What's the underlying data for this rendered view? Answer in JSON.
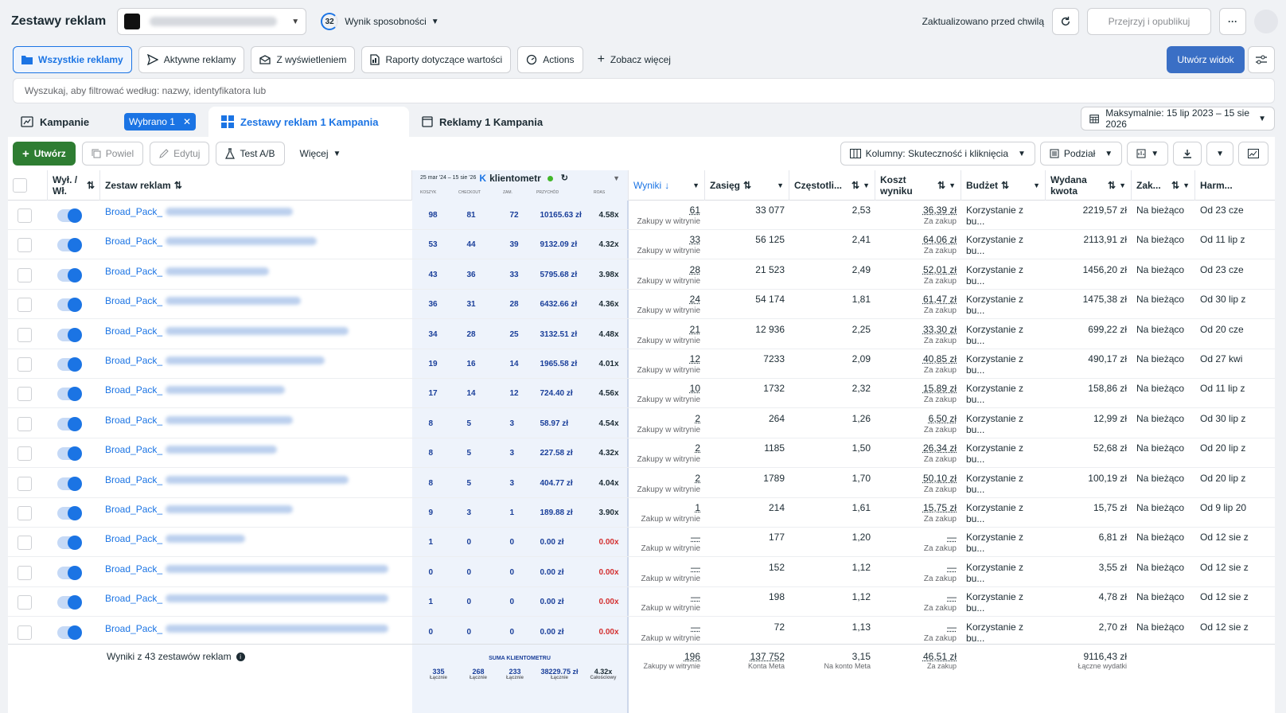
{
  "header": {
    "title": "Zestawy reklam",
    "score_value": "32",
    "score_label": "Wynik sposobności",
    "updated": "Zaktualizowano przed chwilą",
    "review_publish": "Przejrzyj i opublikuj",
    "more": "···"
  },
  "views": {
    "items": [
      "Wszystkie reklamy",
      "Aktywne reklamy",
      "Z wyświetleniem",
      "Raporty dotyczące wartości",
      "Actions",
      "Zobacz więcej"
    ],
    "create_view": "Utwórz widok"
  },
  "search": {
    "placeholder": "Wyszukaj, aby filtrować według: nazwy, identyfikatora lub"
  },
  "levels": {
    "campaigns": "Kampanie",
    "selected_chip": "Wybrano 1",
    "adsets": "Zestawy reklam 1 Kampania",
    "ads": "Reklamy 1 Kampania",
    "date_range": "Maksymalnie: 15 lip 2023 – 15 sie 2026"
  },
  "toolbar": {
    "create": "Utwórz",
    "duplicate": "Powiel",
    "edit": "Edytuj",
    "abtest": "Test A/B",
    "more": "Więcej",
    "columns": "Kolumny: Skuteczność i kliknięcia",
    "breakdown": "Podział"
  },
  "columns": {
    "onoff": "Wył. / Wł.",
    "adset": "Zestaw reklam",
    "kt_date": "25 mar '24 – 15 sie '26",
    "kt_brand": "klientometr",
    "kt_sub": [
      "KOSZYK",
      "CHECKOUT",
      "ZAM.",
      "PRZYCHÓD",
      "ROAS"
    ],
    "results": "Wyniki",
    "reach": "Zasięg",
    "frequency": "Częstotli...",
    "cost": "Koszt wyniku",
    "budget": "Budżet",
    "spent": "Wydana kwota",
    "end": "Zak...",
    "schedule": "Harm..."
  },
  "rows": [
    {
      "name": "Broad_Pack_",
      "k1": "98",
      "k2": "81",
      "k3": "72",
      "rev": "10165.63 zł",
      "roas": "4.58x",
      "res": "61",
      "res_sub": "Zakupy w witrynie",
      "reach": "33 077",
      "freq": "2,53",
      "cost": "36,39 zł",
      "cost_sub": "Za zakup",
      "budget": "Korzystanie z bu...",
      "spent": "2219,57 zł",
      "end": "Na bieżąco",
      "sched": "Od 23 cze"
    },
    {
      "name": "Broad_Pack_",
      "k1": "53",
      "k2": "44",
      "k3": "39",
      "rev": "9132.09 zł",
      "roas": "4.32x",
      "res": "33",
      "res_sub": "Zakupy w witrynie",
      "reach": "56 125",
      "freq": "2,41",
      "cost": "64,06 zł",
      "cost_sub": "Za zakup",
      "budget": "Korzystanie z bu...",
      "spent": "2113,91 zł",
      "end": "Na bieżąco",
      "sched": "Od 11 lip z"
    },
    {
      "name": "Broad_Pack_",
      "k1": "43",
      "k2": "36",
      "k3": "33",
      "rev": "5795.68 zł",
      "roas": "3.98x",
      "res": "28",
      "res_sub": "Zakupy w witrynie",
      "reach": "21 523",
      "freq": "2,49",
      "cost": "52,01 zł",
      "cost_sub": "Za zakup",
      "budget": "Korzystanie z bu...",
      "spent": "1456,20 zł",
      "end": "Na bieżąco",
      "sched": "Od 23 cze"
    },
    {
      "name": "Broad_Pack_",
      "k1": "36",
      "k2": "31",
      "k3": "28",
      "rev": "6432.66 zł",
      "roas": "4.36x",
      "res": "24",
      "res_sub": "Zakupy w witrynie",
      "reach": "54 174",
      "freq": "1,81",
      "cost": "61,47 zł",
      "cost_sub": "Za zakup",
      "budget": "Korzystanie z bu...",
      "spent": "1475,38 zł",
      "end": "Na bieżąco",
      "sched": "Od 30 lip z"
    },
    {
      "name": "Broad_Pack_",
      "k1": "34",
      "k2": "28",
      "k3": "25",
      "rev": "3132.51 zł",
      "roas": "4.48x",
      "res": "21",
      "res_sub": "Zakupy w witrynie",
      "reach": "12 936",
      "freq": "2,25",
      "cost": "33,30 zł",
      "cost_sub": "Za zakup",
      "budget": "Korzystanie z bu...",
      "spent": "699,22 zł",
      "end": "Na bieżąco",
      "sched": "Od 20 cze"
    },
    {
      "name": "Broad_Pack_",
      "k1": "19",
      "k2": "16",
      "k3": "14",
      "rev": "1965.58 zł",
      "roas": "4.01x",
      "res": "12",
      "res_sub": "Zakupy w witrynie",
      "reach": "7233",
      "freq": "2,09",
      "cost": "40,85 zł",
      "cost_sub": "Za zakup",
      "budget": "Korzystanie z bu...",
      "spent": "490,17 zł",
      "end": "Na bieżąco",
      "sched": "Od 27 kwi"
    },
    {
      "name": "Broad_Pack_",
      "k1": "17",
      "k2": "14",
      "k3": "12",
      "rev": "724.40 zł",
      "roas": "4.56x",
      "res": "10",
      "res_sub": "Zakupy w witrynie",
      "reach": "1732",
      "freq": "2,32",
      "cost": "15,89 zł",
      "cost_sub": "Za zakup",
      "budget": "Korzystanie z bu...",
      "spent": "158,86 zł",
      "end": "Na bieżąco",
      "sched": "Od 11 lip z"
    },
    {
      "name": "Broad_Pack_",
      "k1": "8",
      "k2": "5",
      "k3": "3",
      "rev": "58.97 zł",
      "roas": "4.54x",
      "res": "2",
      "res_sub": "Zakupy w witrynie",
      "reach": "264",
      "freq": "1,26",
      "cost": "6,50 zł",
      "cost_sub": "Za zakup",
      "budget": "Korzystanie z bu...",
      "spent": "12,99 zł",
      "end": "Na bieżąco",
      "sched": "Od 30 lip z"
    },
    {
      "name": "Broad_Pack_",
      "k1": "8",
      "k2": "5",
      "k3": "3",
      "rev": "227.58 zł",
      "roas": "4.32x",
      "res": "2",
      "res_sub": "Zakupy w witrynie",
      "reach": "1185",
      "freq": "1,50",
      "cost": "26,34 zł",
      "cost_sub": "Za zakup",
      "budget": "Korzystanie z bu...",
      "spent": "52,68 zł",
      "end": "Na bieżąco",
      "sched": "Od 20 lip z"
    },
    {
      "name": "Broad_Pack_",
      "k1": "8",
      "k2": "5",
      "k3": "3",
      "rev": "404.77 zł",
      "roas": "4.04x",
      "res": "2",
      "res_sub": "Zakupy w witrynie",
      "reach": "1789",
      "freq": "1,70",
      "cost": "50,10 zł",
      "cost_sub": "Za zakup",
      "budget": "Korzystanie z bu...",
      "spent": "100,19 zł",
      "end": "Na bieżąco",
      "sched": "Od 20 lip z"
    },
    {
      "name": "Broad_Pack_",
      "k1": "9",
      "k2": "3",
      "k3": "1",
      "rev": "189.88 zł",
      "roas": "3.90x",
      "res": "1",
      "res_sub": "Zakup w witrynie",
      "reach": "214",
      "freq": "1,61",
      "cost": "15,75 zł",
      "cost_sub": "Za zakup",
      "budget": "Korzystanie z bu...",
      "spent": "15,75 zł",
      "end": "Na bieżąco",
      "sched": "Od 9 lip 20"
    },
    {
      "name": "Broad_Pack_",
      "k1": "1",
      "k2": "0",
      "k3": "0",
      "rev": "0.00 zł",
      "roas": "0.00x",
      "res": "—",
      "res_sub": "Zakup w witrynie",
      "reach": "177",
      "freq": "1,20",
      "cost": "—",
      "cost_sub": "Za zakup",
      "budget": "Korzystanie z bu...",
      "spent": "6,81 zł",
      "end": "Na bieżąco",
      "sched": "Od 12 sie z"
    },
    {
      "name": "Broad_Pack_",
      "k1": "0",
      "k2": "0",
      "k3": "0",
      "rev": "0.00 zł",
      "roas": "0.00x",
      "res": "—",
      "res_sub": "Zakup w witrynie",
      "reach": "152",
      "freq": "1,12",
      "cost": "—",
      "cost_sub": "Za zakup",
      "budget": "Korzystanie z bu...",
      "spent": "3,55 zł",
      "end": "Na bieżąco",
      "sched": "Od 12 sie z"
    },
    {
      "name": "Broad_Pack_",
      "k1": "1",
      "k2": "0",
      "k3": "0",
      "rev": "0.00 zł",
      "roas": "0.00x",
      "res": "—",
      "res_sub": "Zakup w witrynie",
      "reach": "198",
      "freq": "1,12",
      "cost": "—",
      "cost_sub": "Za zakup",
      "budget": "Korzystanie z bu...",
      "spent": "4,78 zł",
      "end": "Na bieżąco",
      "sched": "Od 12 sie z"
    },
    {
      "name": "Broad_Pack_",
      "k1": "0",
      "k2": "0",
      "k3": "0",
      "rev": "0.00 zł",
      "roas": "0.00x",
      "res": "—",
      "res_sub": "Zakup w witrynie",
      "reach": "72",
      "freq": "1,13",
      "cost": "—",
      "cost_sub": "Za zakup",
      "budget": "Korzystanie z bu...",
      "spent": "2,70 zł",
      "end": "Na bieżąco",
      "sched": "Od 12 sie z"
    }
  ],
  "footer": {
    "label": "Wyniki z 43 zestawów reklam",
    "kt_title": "SUMA KLIENTOMETRU",
    "k1": "335",
    "k2": "268",
    "k3": "233",
    "rev": "38229.75 zł",
    "roas": "4.32x",
    "k_sub": "Łącznie",
    "roas_sub": "Całościowy",
    "res": "196",
    "res_sub": "Zakupy w witrynie",
    "reach": "137 752",
    "reach_sub": "Konta Meta",
    "freq": "3,15",
    "freq_sub": "Na konto Meta",
    "cost": "46,51 zł",
    "cost_sub": "Za zakup",
    "spent": "9116,43 zł",
    "spent_sub": "Łączne wydatki"
  },
  "colors": {
    "accent": "#1b74e4",
    "create_green": "#2e7d32",
    "zero_roas": "#d32f2f"
  }
}
